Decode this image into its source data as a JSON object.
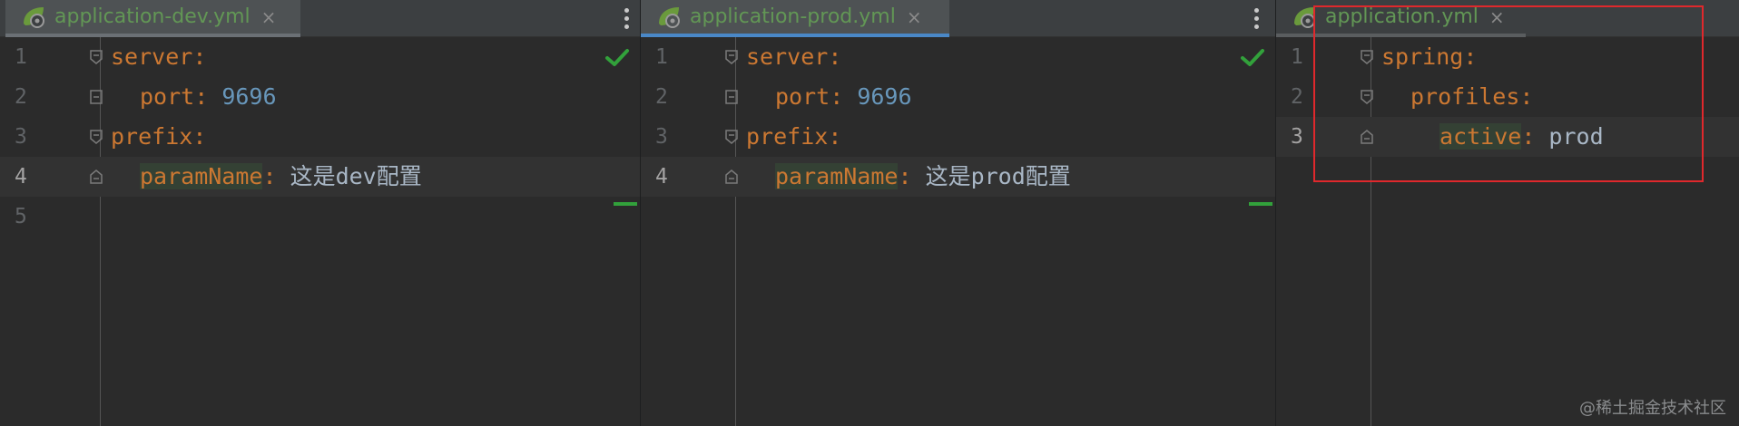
{
  "panes": [
    {
      "tab_label": "application-dev.yml",
      "close_glyph": "×",
      "lines": [
        {
          "num": "1",
          "key": "server",
          "sep": ":",
          "value": ""
        },
        {
          "num": "2",
          "key": "port",
          "sep": ": ",
          "value": "9696"
        },
        {
          "num": "3",
          "key": "prefix",
          "sep": ":",
          "value": ""
        },
        {
          "num": "4",
          "key": "paramName",
          "sep": ": ",
          "value": "这是dev配置"
        },
        {
          "num": "5",
          "key": "",
          "sep": "",
          "value": ""
        }
      ]
    },
    {
      "tab_label": "application-prod.yml",
      "close_glyph": "×",
      "lines": [
        {
          "num": "1",
          "key": "server",
          "sep": ":",
          "value": ""
        },
        {
          "num": "2",
          "key": "port",
          "sep": ": ",
          "value": "9696"
        },
        {
          "num": "3",
          "key": "prefix",
          "sep": ":",
          "value": ""
        },
        {
          "num": "4",
          "key": "paramName",
          "sep": ": ",
          "value": "这是prod配置"
        }
      ]
    },
    {
      "tab_label": "application.yml",
      "close_glyph": "×",
      "lines": [
        {
          "num": "1",
          "key": "spring",
          "sep": ":",
          "value": ""
        },
        {
          "num": "2",
          "key": "profiles",
          "sep": ":",
          "value": ""
        },
        {
          "num": "3",
          "key": "active",
          "sep": ": ",
          "value": "prod"
        }
      ]
    }
  ],
  "watermark": "@稀土掘金技术社区",
  "icons": {
    "tab": "spring-leaf-icon",
    "menu": "kebab-menu-icon",
    "status": "inspection-ok-check-icon",
    "fold": "fold-marker-icon"
  },
  "colors": {
    "key": "#cc7832",
    "number": "#6897bb",
    "text": "#a9b7c6",
    "tab_label": "#629755",
    "highlight_box": "#e0282c",
    "check": "#32a13b"
  }
}
